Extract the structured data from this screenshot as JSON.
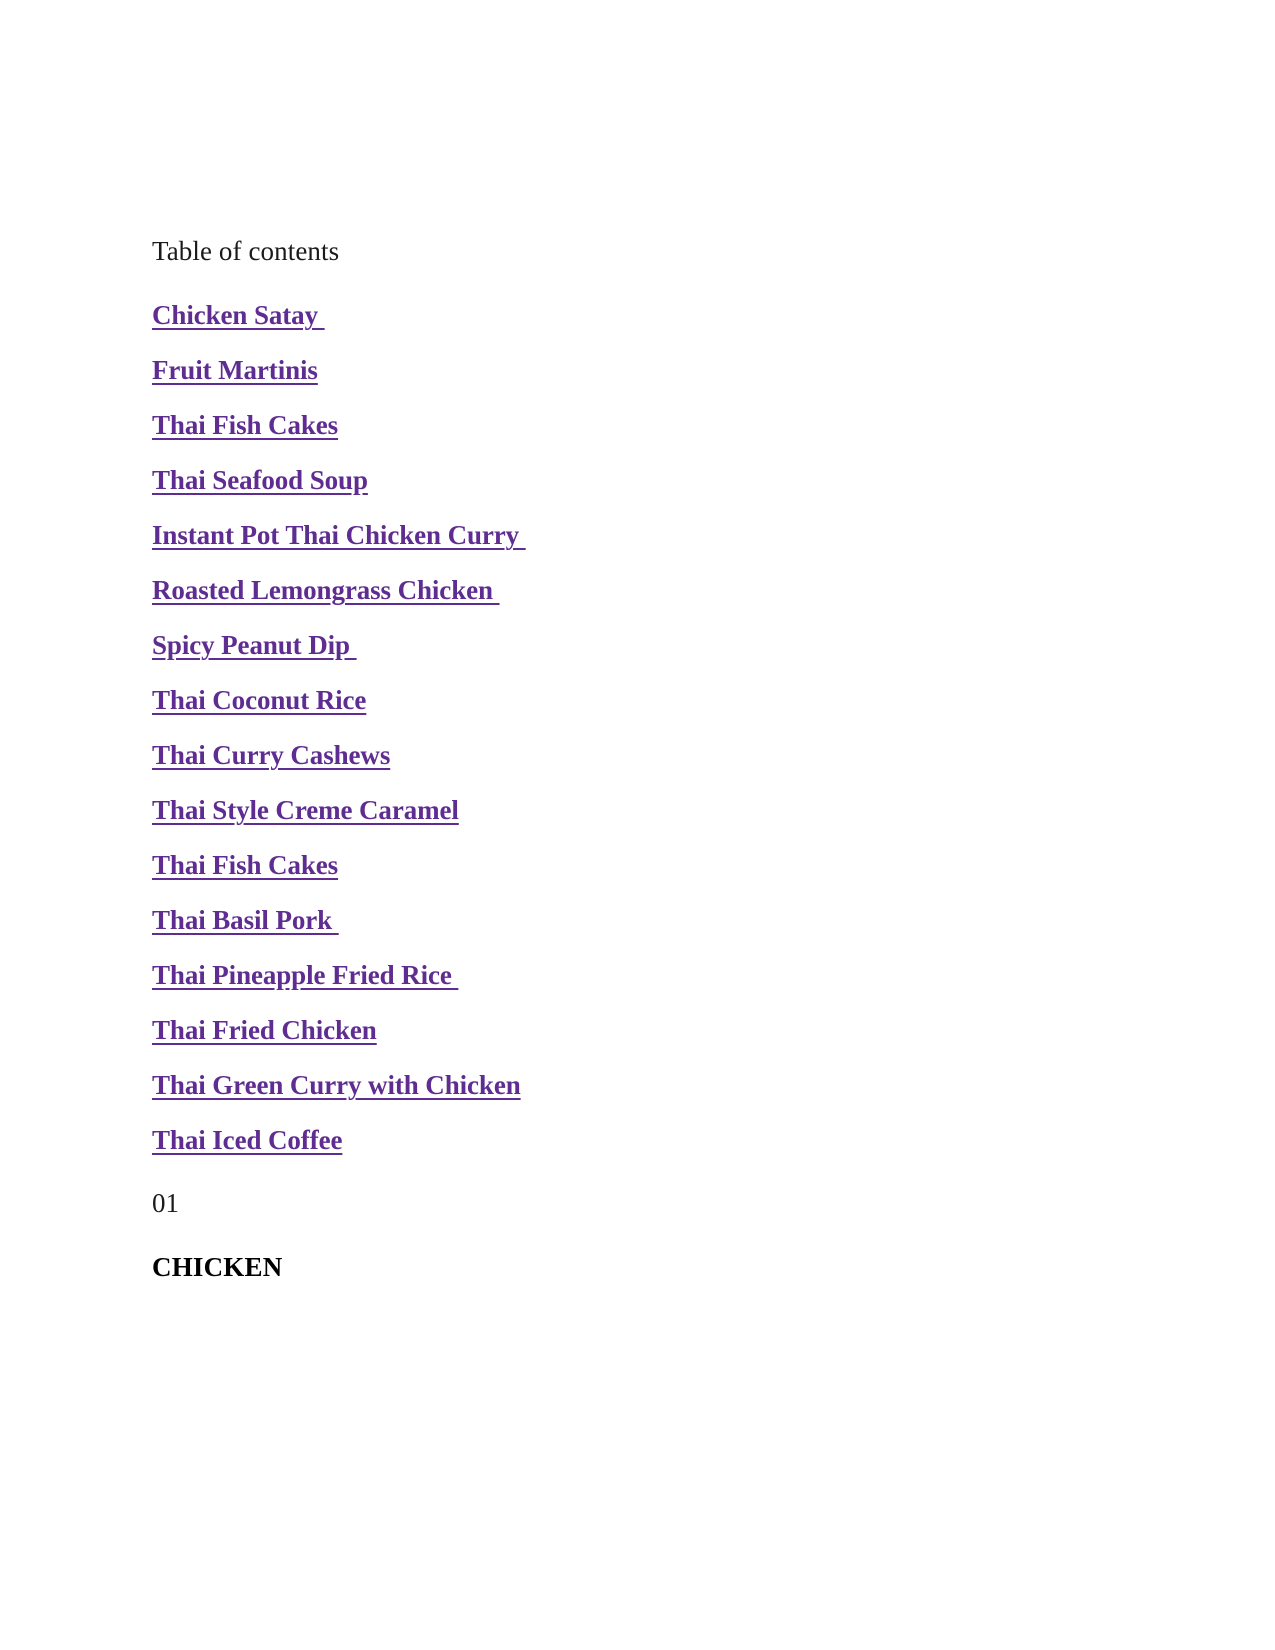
{
  "document": {
    "heading": "Table of contents",
    "toc_items": [
      {
        "label": "Chicken Satay "
      },
      {
        "label": "Fruit Martinis"
      },
      {
        "label": "Thai Fish Cakes"
      },
      {
        "label": "Thai Seafood Soup"
      },
      {
        "label": "Instant Pot Thai Chicken Curry "
      },
      {
        "label": "Roasted Lemongrass Chicken "
      },
      {
        "label": "Spicy Peanut Dip "
      },
      {
        "label": "Thai Coconut Rice"
      },
      {
        "label": "Thai Curry Cashews"
      },
      {
        "label": "Thai Style Creme Caramel"
      },
      {
        "label": "Thai Fish Cakes"
      },
      {
        "label": "Thai Basil Pork "
      },
      {
        "label": "Thai Pineapple Fried Rice "
      },
      {
        "label": "Thai Fried Chicken"
      },
      {
        "label": "Thai Green Curry with Chicken"
      },
      {
        "label": "Thai Iced Coffee"
      }
    ],
    "section_number": "01",
    "section_title": "CHICKEN"
  },
  "colors": {
    "link": "#5F2D91",
    "text": "#1a1a1a",
    "background": "#ffffff"
  }
}
